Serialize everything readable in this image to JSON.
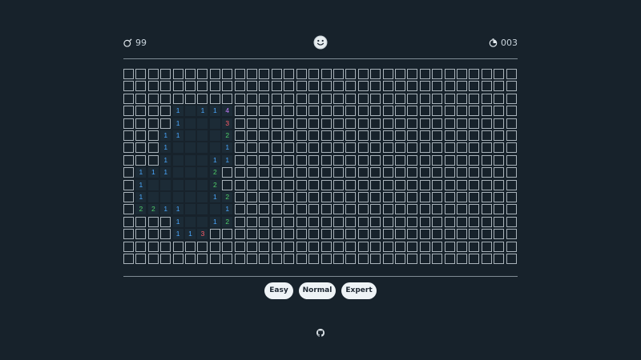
{
  "header": {
    "mine_count": "99",
    "timer": "003",
    "mine_icon": "bomb-icon",
    "timer_icon": "stopwatch-icon",
    "face_icon": "smiley-face-icon"
  },
  "board": {
    "columns": 32,
    "rows": 16,
    "revealed": [
      [
        3,
        4,
        "1"
      ],
      [
        3,
        5,
        ""
      ],
      [
        3,
        6,
        "1"
      ],
      [
        3,
        7,
        "1"
      ],
      [
        3,
        8,
        "4"
      ],
      [
        4,
        4,
        "1"
      ],
      [
        4,
        5,
        ""
      ],
      [
        4,
        6,
        ""
      ],
      [
        4,
        7,
        ""
      ],
      [
        4,
        8,
        "3"
      ],
      [
        5,
        3,
        "1"
      ],
      [
        5,
        4,
        "1"
      ],
      [
        5,
        5,
        ""
      ],
      [
        5,
        6,
        ""
      ],
      [
        5,
        7,
        ""
      ],
      [
        5,
        8,
        "2"
      ],
      [
        6,
        3,
        "1"
      ],
      [
        6,
        4,
        ""
      ],
      [
        6,
        5,
        ""
      ],
      [
        6,
        6,
        ""
      ],
      [
        6,
        7,
        ""
      ],
      [
        6,
        8,
        "1"
      ],
      [
        7,
        3,
        "1"
      ],
      [
        7,
        4,
        ""
      ],
      [
        7,
        5,
        ""
      ],
      [
        7,
        6,
        ""
      ],
      [
        7,
        7,
        "1"
      ],
      [
        7,
        8,
        "1"
      ],
      [
        8,
        1,
        "1"
      ],
      [
        8,
        2,
        "1"
      ],
      [
        8,
        3,
        "1"
      ],
      [
        8,
        4,
        ""
      ],
      [
        8,
        5,
        ""
      ],
      [
        8,
        6,
        ""
      ],
      [
        8,
        7,
        "2"
      ],
      [
        9,
        1,
        "1"
      ],
      [
        9,
        2,
        ""
      ],
      [
        9,
        3,
        ""
      ],
      [
        9,
        4,
        ""
      ],
      [
        9,
        5,
        ""
      ],
      [
        9,
        6,
        ""
      ],
      [
        9,
        7,
        "2"
      ],
      [
        10,
        1,
        "1"
      ],
      [
        10,
        2,
        ""
      ],
      [
        10,
        3,
        ""
      ],
      [
        10,
        4,
        ""
      ],
      [
        10,
        5,
        ""
      ],
      [
        10,
        6,
        ""
      ],
      [
        10,
        7,
        "1"
      ],
      [
        10,
        8,
        "2"
      ],
      [
        11,
        1,
        "2"
      ],
      [
        11,
        2,
        "2"
      ],
      [
        11,
        3,
        "1"
      ],
      [
        11,
        4,
        "1"
      ],
      [
        11,
        5,
        ""
      ],
      [
        11,
        6,
        ""
      ],
      [
        11,
        7,
        ""
      ],
      [
        11,
        8,
        "1"
      ],
      [
        12,
        4,
        "1"
      ],
      [
        12,
        5,
        ""
      ],
      [
        12,
        6,
        ""
      ],
      [
        12,
        7,
        "1"
      ],
      [
        12,
        8,
        "2"
      ],
      [
        13,
        4,
        "1"
      ],
      [
        13,
        5,
        "1"
      ],
      [
        13,
        6,
        "3"
      ]
    ]
  },
  "difficulty": {
    "easy_label": "Easy",
    "normal_label": "Normal",
    "expert_label": "Expert"
  },
  "footer": {
    "github_icon": "github-icon"
  },
  "colors": {
    "background": "#17222b",
    "cell_border": "#a9b3ba",
    "open_cell": "#1c2b36",
    "n1": "#4aa8ff",
    "n2": "#4fd06a",
    "n3": "#ff5d6a",
    "n4": "#c77dff"
  }
}
